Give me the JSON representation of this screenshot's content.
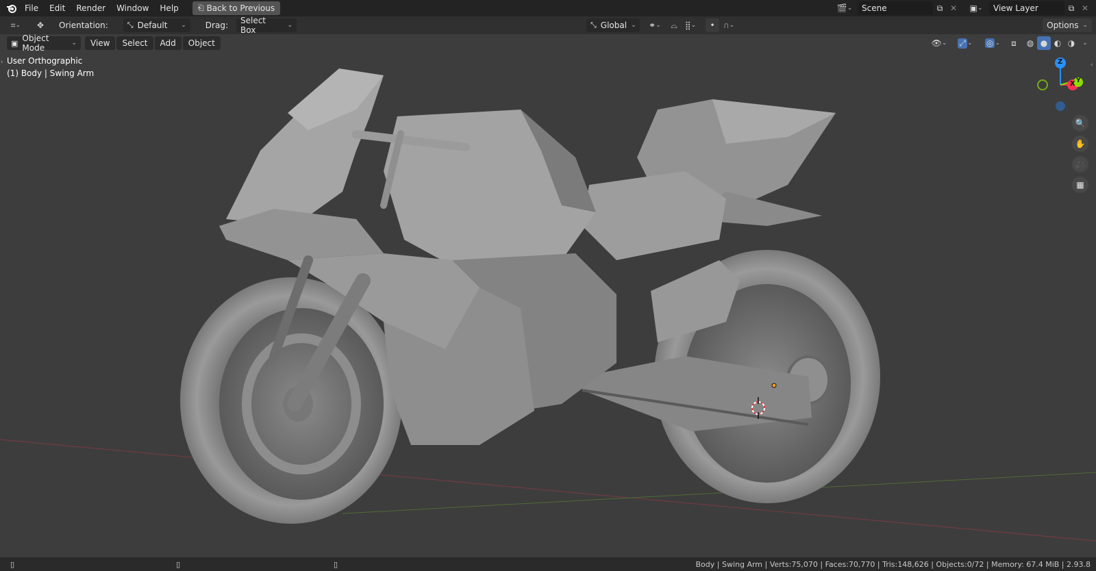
{
  "topbar": {
    "menus": [
      "File",
      "Edit",
      "Render",
      "Window",
      "Help"
    ],
    "back_button": "Back to Previous",
    "scene_value": "Scene",
    "view_layer_value": "View Layer"
  },
  "tool_header": {
    "orientation_label": "Orientation:",
    "orientation_value": "Default",
    "drag_label": "Drag:",
    "drag_value": "Select Box",
    "transform_orientation": "Global",
    "options_label": "Options"
  },
  "viewport_header": {
    "mode": "Object Mode",
    "menus": [
      "View",
      "Select",
      "Add",
      "Object"
    ]
  },
  "overlay": {
    "view_name": "User Orthographic",
    "object_info": "(1) Body | Swing Arm"
  },
  "gizmo": {
    "z": "Z",
    "x": "X",
    "y": "Y"
  },
  "status": {
    "text": "Body | Swing Arm | Verts:75,070 | Faces:70,770 | Tris:148,626 | Objects:0/72 | Memory: 67.4 MiB | 2.93.8"
  },
  "colors": {
    "accent": "#4772b3",
    "axis_x": "#ff3352",
    "axis_y": "#8bdc00",
    "axis_z": "#2890ff"
  }
}
